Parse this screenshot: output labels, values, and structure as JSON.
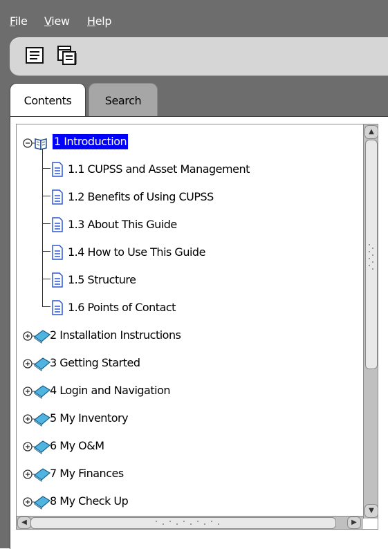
{
  "menu": {
    "items": [
      {
        "mnemonic": "F",
        "rest": "ile"
      },
      {
        "mnemonic": "V",
        "rest": "iew"
      },
      {
        "mnemonic": "H",
        "rest": "elp"
      }
    ]
  },
  "toolbar": {
    "buttons": [
      {
        "icon": "document-list-icon"
      },
      {
        "icon": "copy-window-icon"
      }
    ]
  },
  "tabs": {
    "contents": "Contents",
    "search": "Search",
    "active": "Contents"
  },
  "tree": {
    "chapter1": {
      "label": "1 Introduction",
      "expanded": true,
      "selected": true
    },
    "sections": [
      {
        "label": "1.1 CUPSS and Asset Management"
      },
      {
        "label": "1.2 Benefits of Using CUPSS"
      },
      {
        "label": "1.3 About This Guide"
      },
      {
        "label": "1.4 How to Use This Guide"
      },
      {
        "label": "1.5 Structure"
      },
      {
        "label": "1.6 Points of Contact"
      }
    ],
    "chapters": [
      {
        "label": "2 Installation Instructions"
      },
      {
        "label": "3 Getting Started"
      },
      {
        "label": "4 Login and Navigation"
      },
      {
        "label": "5 My Inventory"
      },
      {
        "label": "6 My O&M"
      },
      {
        "label": "7 My Finances"
      },
      {
        "label": "8 My Check Up"
      }
    ]
  },
  "colors": {
    "frame_bg": "#6d6d6d",
    "selection_bg": "#0000ff",
    "book_icon": "#3aa0d0",
    "page_icon": "#2b57d6"
  }
}
